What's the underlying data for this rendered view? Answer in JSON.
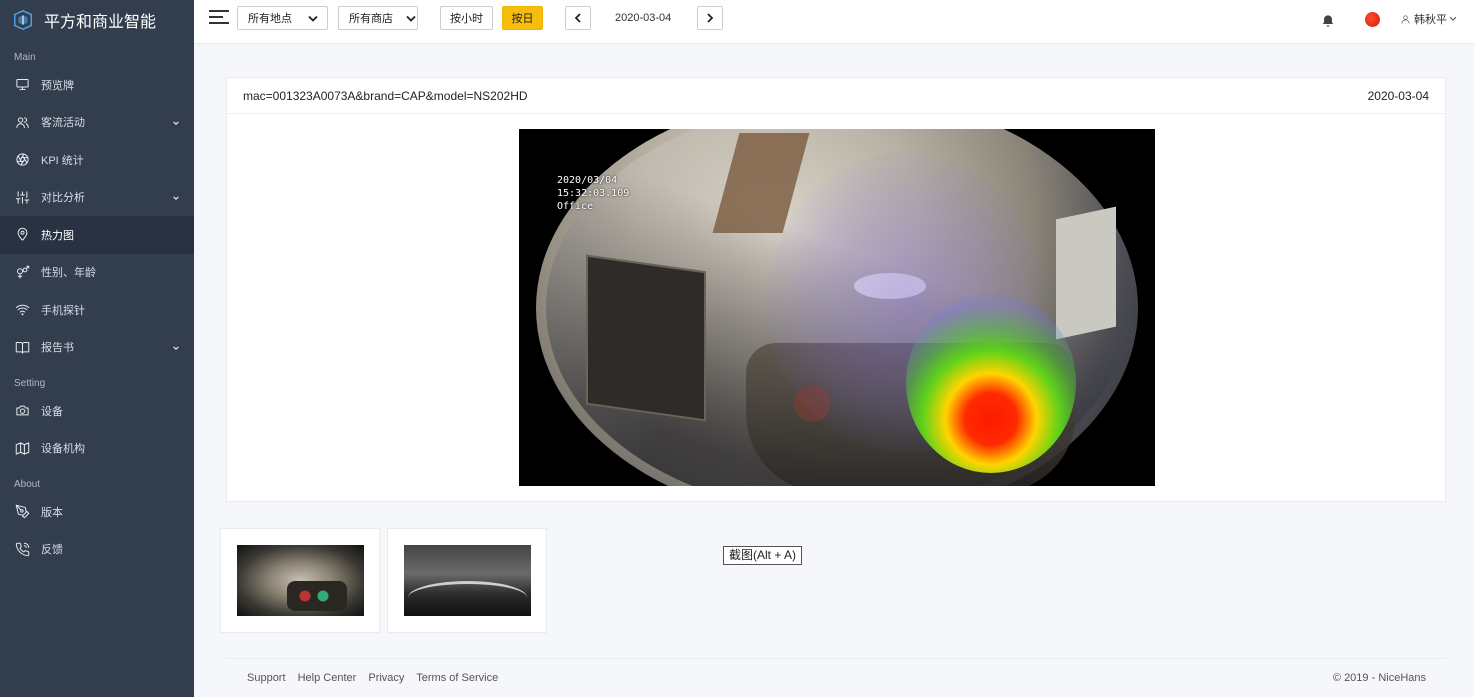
{
  "brand": {
    "name": "平方和商业智能"
  },
  "sidebar": {
    "sections": {
      "main": "Main",
      "setting": "Setting",
      "about": "About"
    },
    "items": [
      {
        "label": "预览牌",
        "icon": "monitor-icon"
      },
      {
        "label": "客流活动",
        "icon": "users-icon",
        "has_children": true
      },
      {
        "label": "KPI 统计",
        "icon": "aperture-icon"
      },
      {
        "label": "对比分析",
        "icon": "sliders-icon",
        "has_children": true
      },
      {
        "label": "热力图",
        "icon": "map-pin-icon",
        "active": true
      },
      {
        "label": "性别、年龄",
        "icon": "gender-icon"
      },
      {
        "label": "手机探针",
        "icon": "wifi-icon"
      },
      {
        "label": "报告书",
        "icon": "book-icon",
        "has_children": true
      },
      {
        "label": "设备",
        "icon": "camera-icon"
      },
      {
        "label": "设备机构",
        "icon": "map-icon"
      },
      {
        "label": "版本",
        "icon": "pen-tool-icon"
      },
      {
        "label": "反馈",
        "icon": "phone-icon"
      }
    ]
  },
  "topbar": {
    "location_select": "所有地点",
    "store_select": "所有商店",
    "by_hour": "按小时",
    "by_day": "按日",
    "date": "2020-03-04",
    "user_name": "韩秋平"
  },
  "card": {
    "title": "mac=001323A0073A&brand=CAP&model=NS202HD",
    "date": "2020-03-04",
    "osd": {
      "date": "2020/03/04",
      "time": "15:32:03.109",
      "label": "Office"
    }
  },
  "screenshot_tip": "截图(Alt + A)",
  "footer": {
    "links": [
      "Support",
      "Help Center",
      "Privacy",
      "Terms of Service"
    ],
    "copyright": "© 2019 - NiceHans"
  },
  "colors": {
    "sidebar_bg": "#323d4e",
    "accent": "#f7bc0e",
    "avatar": "#e0220c"
  }
}
